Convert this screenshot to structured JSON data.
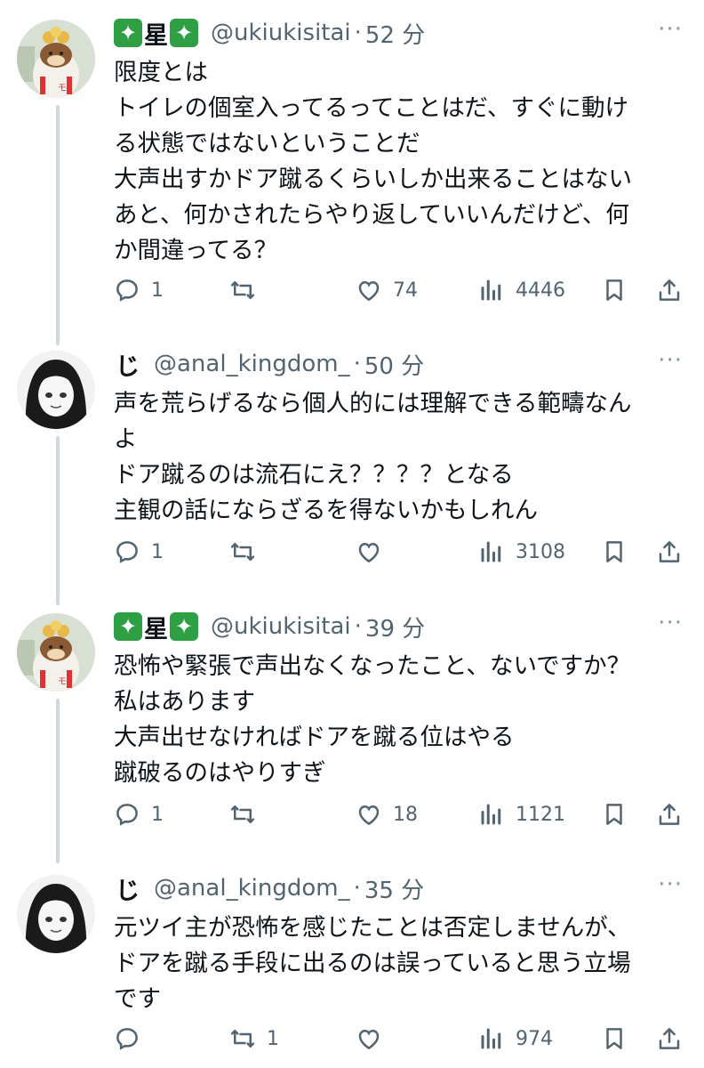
{
  "thread": [
    {
      "badge_left": "✦",
      "name": "星",
      "badge_right": "✦",
      "handle": "@ukiukisitai",
      "separator": "·",
      "time": "52 分",
      "more": "···",
      "lines": [
        "限度とは",
        "トイレの個室入ってるってことはだ、すぐに動け",
        "る状態ではないということだ",
        "大声出すかドア蹴るくらいしか出来ることはない",
        "あと、何かされたらやり返していいんだけど、何",
        "か間違ってる？"
      ],
      "actions": {
        "reply": "1",
        "retweet": "",
        "like": "74",
        "views": "4446"
      }
    },
    {
      "badge_left": "",
      "name": "じ",
      "badge_right": "",
      "handle": "@anal_kingdom_",
      "separator": "·",
      "time": "50 分",
      "more": "···",
      "lines": [
        "声を荒らげるなら個人的には理解できる範疇なん",
        "よ",
        "ドア蹴るのは流石にえ？？？？となる",
        "主観の話にならざるを得ないかもしれん"
      ],
      "actions": {
        "reply": "1",
        "retweet": "",
        "like": "",
        "views": "3108"
      }
    },
    {
      "badge_left": "✦",
      "name": "星",
      "badge_right": "✦",
      "handle": "@ukiukisitai",
      "separator": "·",
      "time": "39 分",
      "more": "···",
      "lines": [
        "恐怖や緊張で声出なくなったこと、ないですか？",
        "私はあります",
        "大声出せなければドアを蹴る位はやる",
        "蹴破るのはやりすぎ"
      ],
      "actions": {
        "reply": "1",
        "retweet": "",
        "like": "18",
        "views": "1121"
      }
    },
    {
      "badge_left": "",
      "name": "じ",
      "badge_right": "",
      "handle": "@anal_kingdom_",
      "separator": "·",
      "time": "35 分",
      "more": "···",
      "lines": [
        "元ツイ主が恐怖を感じたことは否定しませんが、",
        "ドアを蹴る手段に出るのは誤っていると思う立場",
        "です"
      ],
      "actions": {
        "reply": "",
        "retweet": "1",
        "like": "",
        "views": "974"
      }
    }
  ],
  "colors": {
    "text": "#0f1419",
    "muted": "#536471",
    "thread_line": "#cfd9de",
    "badge": "#2ea043"
  },
  "icons": [
    "reply-icon",
    "retweet-icon",
    "like-icon",
    "views-icon",
    "bookmark-icon",
    "share-icon",
    "more-icon"
  ]
}
